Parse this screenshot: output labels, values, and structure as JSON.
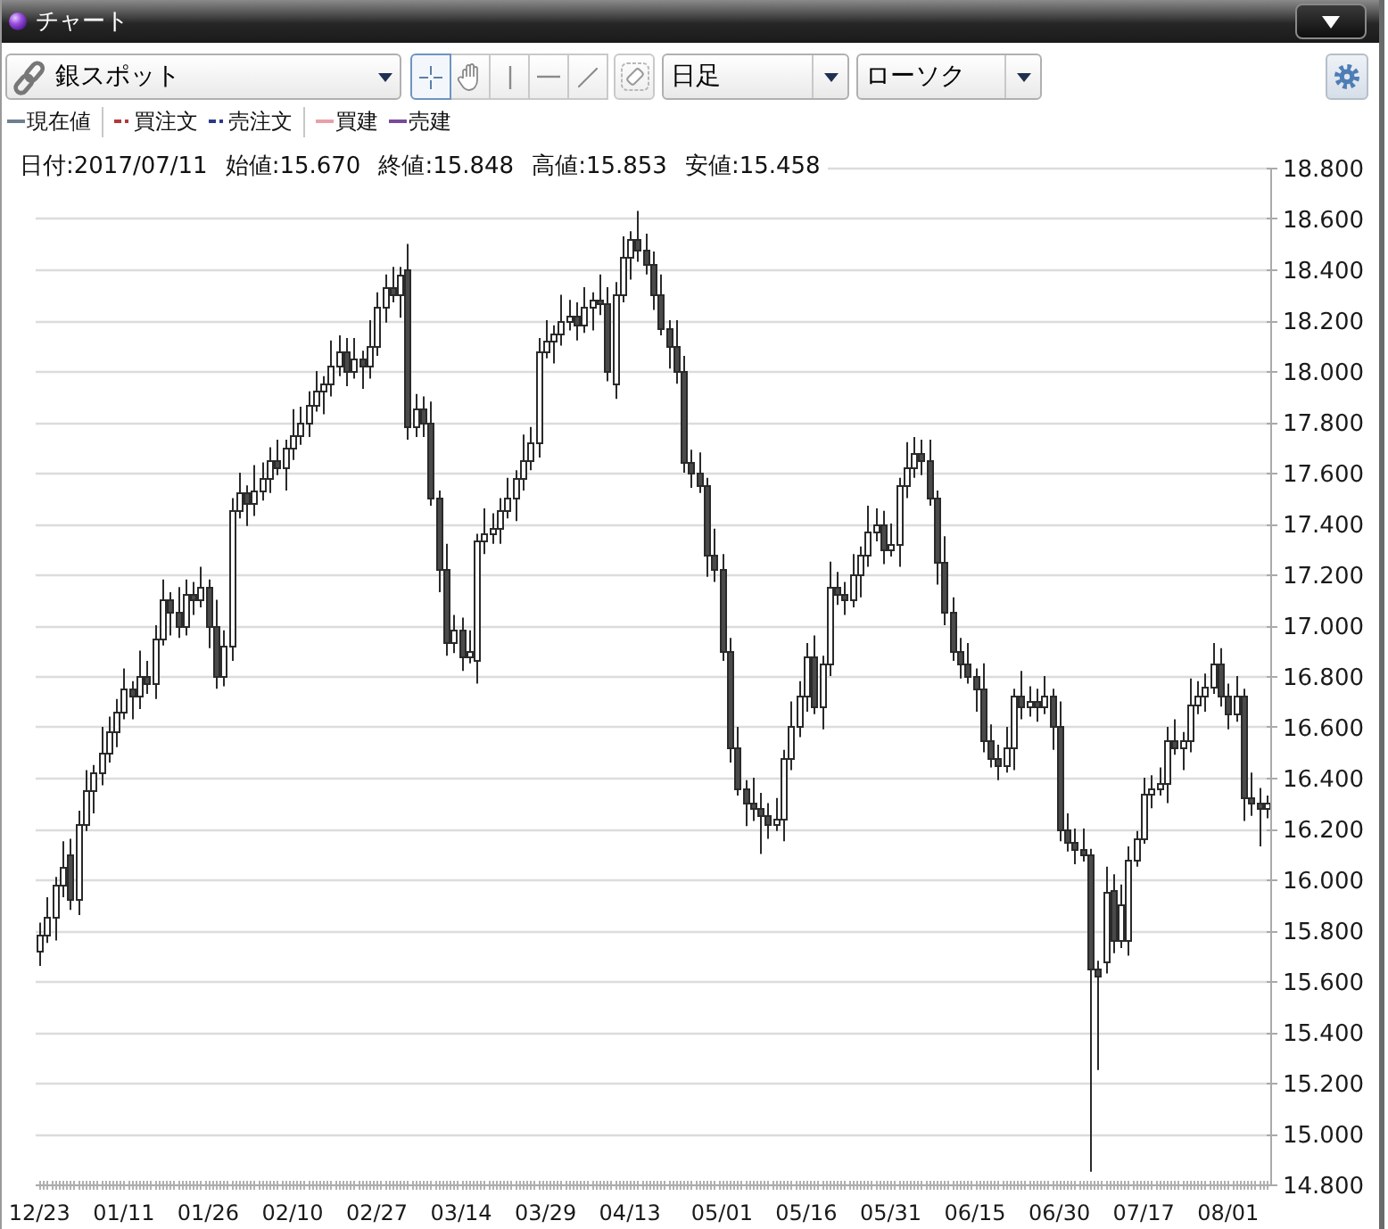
{
  "window": {
    "title": "チャート"
  },
  "toolbar": {
    "symbol": "銀スポット",
    "tools": [
      {
        "kind": "crosshair",
        "selected": true
      },
      {
        "kind": "hand",
        "selected": false
      },
      {
        "kind": "vertical-line",
        "selected": false
      },
      {
        "kind": "horizontal-line",
        "selected": false
      },
      {
        "kind": "trend-line",
        "selected": false
      },
      {
        "kind": "eraser",
        "selected": false
      }
    ],
    "period": "日足",
    "chart_type": "ローソク"
  },
  "legend": {
    "groups": [
      {
        "items": [
          {
            "label": "現在値",
            "color": "#6f7f8f",
            "kind": "solid"
          }
        ]
      },
      {
        "items": [
          {
            "label": "買注文",
            "color": "#b03a3a",
            "kind": "dashed"
          },
          {
            "label": "売注文",
            "color": "#2a3a8a",
            "kind": "dashed"
          }
        ]
      },
      {
        "items": [
          {
            "label": "買建",
            "color": "#e8a0a8",
            "kind": "solid"
          },
          {
            "label": "売建",
            "color": "#7a4a9a",
            "kind": "solid"
          }
        ]
      }
    ]
  },
  "ohlc_info": [
    "日付:2017/07/11",
    "始値:15.670",
    "終値:15.848",
    "高値:15.853",
    "安値:15.458"
  ],
  "chart": {
    "chart_data": {
      "type": "candlestick",
      "grid": true,
      "categories": [
        "12/23",
        null,
        null,
        null,
        null,
        null,
        null,
        null,
        null,
        null,
        null,
        "01/11",
        null,
        null,
        null,
        null,
        null,
        null,
        null,
        null,
        null,
        null,
        "01/26",
        null,
        null,
        null,
        null,
        null,
        null,
        null,
        null,
        null,
        null,
        "02/10",
        null,
        null,
        null,
        null,
        null,
        null,
        null,
        null,
        null,
        null,
        "02/27",
        null,
        null,
        null,
        null,
        null,
        null,
        null,
        null,
        null,
        null,
        "03/14",
        null,
        null,
        null,
        null,
        null,
        null,
        null,
        null,
        null,
        null,
        "03/29",
        null,
        null,
        null,
        null,
        null,
        null,
        null,
        null,
        null,
        null,
        "04/13",
        null,
        null,
        null,
        null,
        null,
        null,
        null,
        null,
        null,
        null,
        null,
        "05/01",
        null,
        null,
        null,
        null,
        null,
        null,
        null,
        null,
        null,
        null,
        "05/16",
        null,
        null,
        null,
        null,
        null,
        null,
        null,
        null,
        null,
        null,
        "05/31",
        null,
        null,
        null,
        null,
        null,
        null,
        null,
        null,
        null,
        null,
        "06/15",
        null,
        null,
        null,
        null,
        null,
        null,
        null,
        null,
        null,
        null,
        "06/30",
        null,
        null,
        null,
        null,
        null,
        null,
        null,
        null,
        null,
        null,
        "07/17",
        null,
        null,
        null,
        null,
        null,
        null,
        null,
        null,
        null,
        null,
        "08/01",
        null,
        null,
        null,
        null,
        null
      ],
      "ohlc": [
        [
          15.72,
          15.83,
          15.66,
          15.78
        ],
        [
          15.78,
          15.93,
          15.75,
          15.85
        ],
        [
          15.85,
          16.01,
          15.76,
          15.98
        ],
        [
          15.98,
          16.15,
          15.93,
          16.05
        ],
        [
          16.1,
          16.16,
          15.88,
          15.92
        ],
        [
          15.92,
          16.27,
          15.86,
          16.22
        ],
        [
          16.22,
          16.43,
          16.19,
          16.35
        ],
        [
          16.35,
          16.45,
          16.26,
          16.42
        ],
        [
          16.42,
          16.6,
          16.37,
          16.5
        ],
        [
          16.5,
          16.64,
          16.46,
          16.58
        ],
        [
          16.58,
          16.71,
          16.52,
          16.66
        ],
        [
          16.66,
          16.83,
          16.63,
          16.75
        ],
        [
          16.75,
          16.78,
          16.63,
          16.72
        ],
        [
          16.72,
          16.9,
          16.67,
          16.8
        ],
        [
          16.8,
          16.86,
          16.73,
          16.77
        ],
        [
          16.77,
          17.0,
          16.71,
          16.95
        ],
        [
          16.95,
          17.18,
          16.92,
          17.1
        ],
        [
          17.1,
          17.13,
          16.96,
          17.05
        ],
        [
          17.05,
          17.15,
          16.95,
          17.0
        ],
        [
          17.0,
          17.18,
          16.96,
          17.12
        ],
        [
          17.12,
          17.17,
          17.04,
          17.1
        ],
        [
          17.1,
          17.23,
          17.07,
          17.15
        ],
        [
          17.15,
          17.18,
          16.91,
          17.0
        ],
        [
          17.0,
          17.1,
          16.75,
          16.8
        ],
        [
          16.8,
          16.98,
          16.76,
          16.92
        ],
        [
          16.92,
          17.5,
          16.86,
          17.45
        ],
        [
          17.45,
          17.6,
          17.42,
          17.52
        ],
        [
          17.52,
          17.55,
          17.39,
          17.48
        ],
        [
          17.48,
          17.63,
          17.43,
          17.53
        ],
        [
          17.53,
          17.64,
          17.49,
          17.58
        ],
        [
          17.58,
          17.7,
          17.52,
          17.65
        ],
        [
          17.65,
          17.73,
          17.59,
          17.62
        ],
        [
          17.62,
          17.73,
          17.53,
          17.7
        ],
        [
          17.7,
          17.85,
          17.65,
          17.75
        ],
        [
          17.75,
          17.86,
          17.71,
          17.8
        ],
        [
          17.8,
          17.92,
          17.74,
          17.87
        ],
        [
          17.87,
          18.0,
          17.84,
          17.92
        ],
        [
          17.92,
          17.98,
          17.83,
          17.95
        ],
        [
          17.95,
          18.12,
          17.9,
          18.02
        ],
        [
          18.02,
          18.14,
          17.98,
          18.08
        ],
        [
          18.08,
          18.13,
          17.94,
          18.0
        ],
        [
          18.0,
          18.13,
          17.97,
          18.05
        ],
        [
          18.05,
          18.08,
          17.93,
          18.02
        ],
        [
          18.02,
          18.2,
          17.97,
          18.1
        ],
        [
          18.1,
          18.31,
          18.06,
          18.25
        ],
        [
          18.25,
          18.38,
          18.19,
          18.33
        ],
        [
          18.33,
          18.41,
          18.27,
          18.3
        ],
        [
          18.3,
          18.41,
          18.21,
          18.38
        ],
        [
          18.4,
          18.5,
          17.73,
          17.78
        ],
        [
          17.78,
          17.91,
          17.74,
          17.85
        ],
        [
          17.85,
          17.9,
          17.74,
          17.8
        ],
        [
          17.8,
          17.88,
          17.47,
          17.5
        ],
        [
          17.5,
          17.53,
          17.13,
          17.22
        ],
        [
          17.22,
          17.32,
          16.88,
          16.93
        ],
        [
          16.93,
          17.04,
          16.89,
          16.98
        ],
        [
          16.98,
          17.03,
          16.82,
          16.88
        ],
        [
          16.88,
          16.98,
          16.85,
          16.9
        ],
        [
          16.86,
          17.36,
          16.77,
          17.33
        ],
        [
          17.33,
          17.46,
          17.28,
          17.36
        ],
        [
          17.36,
          17.44,
          17.32,
          17.38
        ],
        [
          17.38,
          17.5,
          17.32,
          17.45
        ],
        [
          17.45,
          17.58,
          17.42,
          17.5
        ],
        [
          17.5,
          17.61,
          17.41,
          17.58
        ],
        [
          17.58,
          17.75,
          17.53,
          17.65
        ],
        [
          17.65,
          17.78,
          17.61,
          17.72
        ],
        [
          17.72,
          18.13,
          17.66,
          18.08
        ],
        [
          18.08,
          18.2,
          18.05,
          18.12
        ],
        [
          18.12,
          18.18,
          18.03,
          18.15
        ],
        [
          18.15,
          18.3,
          18.1,
          18.2
        ],
        [
          18.2,
          18.28,
          18.16,
          18.22
        ],
        [
          18.22,
          18.27,
          18.12,
          18.18
        ],
        [
          18.18,
          18.33,
          18.15,
          18.25
        ],
        [
          18.25,
          18.31,
          18.16,
          18.28
        ],
        [
          18.28,
          18.38,
          18.22,
          18.27
        ],
        [
          18.27,
          18.33,
          17.96,
          18.0
        ],
        [
          17.95,
          18.35,
          17.89,
          18.3
        ],
        [
          18.3,
          18.53,
          18.27,
          18.45
        ],
        [
          18.45,
          18.55,
          18.36,
          18.52
        ],
        [
          18.52,
          18.63,
          18.43,
          18.48
        ],
        [
          18.48,
          18.54,
          18.38,
          18.42
        ],
        [
          18.42,
          18.47,
          18.24,
          18.3
        ],
        [
          18.3,
          18.38,
          18.14,
          18.17
        ],
        [
          18.17,
          18.2,
          18.01,
          18.1
        ],
        [
          18.1,
          18.2,
          17.95,
          18.0
        ],
        [
          18.0,
          18.06,
          17.6,
          17.64
        ],
        [
          17.64,
          17.69,
          17.54,
          17.6
        ],
        [
          17.6,
          17.68,
          17.52,
          17.55
        ],
        [
          17.55,
          17.58,
          17.19,
          17.28
        ],
        [
          17.28,
          17.38,
          17.17,
          17.22
        ],
        [
          17.22,
          17.28,
          16.86,
          16.9
        ],
        [
          16.9,
          16.95,
          16.46,
          16.52
        ],
        [
          16.52,
          16.6,
          16.33,
          16.36
        ],
        [
          16.36,
          16.39,
          16.21,
          16.3
        ],
        [
          16.3,
          16.4,
          16.23,
          16.28
        ],
        [
          16.28,
          16.34,
          16.1,
          16.25
        ],
        [
          16.25,
          16.3,
          16.16,
          16.22
        ],
        [
          16.22,
          16.32,
          16.19,
          16.24
        ],
        [
          16.24,
          16.51,
          16.15,
          16.48
        ],
        [
          16.48,
          16.7,
          16.43,
          16.6
        ],
        [
          16.6,
          16.78,
          16.56,
          16.72
        ],
        [
          16.72,
          16.93,
          16.66,
          16.88
        ],
        [
          16.88,
          16.96,
          16.65,
          16.68
        ],
        [
          16.68,
          16.88,
          16.59,
          16.85
        ],
        [
          16.85,
          17.25,
          16.8,
          17.15
        ],
        [
          17.15,
          17.21,
          17.08,
          17.12
        ],
        [
          17.12,
          17.17,
          17.04,
          17.1
        ],
        [
          17.1,
          17.28,
          17.07,
          17.2
        ],
        [
          17.2,
          17.31,
          17.11,
          17.28
        ],
        [
          17.28,
          17.47,
          17.23,
          17.37
        ],
        [
          17.37,
          17.46,
          17.33,
          17.4
        ],
        [
          17.4,
          17.45,
          17.24,
          17.3
        ],
        [
          17.3,
          17.4,
          17.27,
          17.32
        ],
        [
          17.32,
          17.58,
          17.23,
          17.55
        ],
        [
          17.55,
          17.72,
          17.5,
          17.62
        ],
        [
          17.62,
          17.74,
          17.58,
          17.68
        ],
        [
          17.68,
          17.73,
          17.59,
          17.65
        ],
        [
          17.65,
          17.73,
          17.47,
          17.5
        ],
        [
          17.5,
          17.53,
          17.16,
          17.25
        ],
        [
          17.25,
          17.35,
          17.0,
          17.05
        ],
        [
          17.05,
          17.11,
          16.86,
          16.9
        ],
        [
          16.9,
          16.95,
          16.79,
          16.85
        ],
        [
          16.85,
          16.93,
          16.77,
          16.8
        ],
        [
          16.8,
          16.83,
          16.66,
          16.75
        ],
        [
          16.75,
          16.85,
          16.5,
          16.55
        ],
        [
          16.55,
          16.61,
          16.44,
          16.48
        ],
        [
          16.48,
          16.53,
          16.39,
          16.45
        ],
        [
          16.45,
          16.6,
          16.42,
          16.52
        ],
        [
          16.52,
          16.75,
          16.43,
          16.72
        ],
        [
          16.72,
          16.82,
          16.63,
          16.68
        ],
        [
          16.68,
          16.76,
          16.64,
          16.7
        ],
        [
          16.7,
          16.75,
          16.62,
          16.68
        ],
        [
          16.68,
          16.8,
          16.65,
          16.72
        ],
        [
          16.72,
          16.75,
          16.51,
          16.6
        ],
        [
          16.6,
          16.7,
          16.15,
          16.2
        ],
        [
          16.2,
          16.26,
          16.11,
          16.15
        ],
        [
          16.15,
          16.2,
          16.06,
          16.12
        ],
        [
          16.12,
          16.2,
          16.07,
          16.1
        ],
        [
          16.1,
          16.12,
          14.85,
          15.65
        ],
        [
          15.65,
          15.68,
          15.25,
          15.62
        ],
        [
          15.68,
          16.05,
          15.63,
          15.95
        ],
        [
          15.96,
          16.02,
          15.71,
          15.76
        ],
        [
          15.76,
          15.98,
          15.73,
          15.9
        ],
        [
          15.76,
          16.13,
          15.7,
          16.08
        ],
        [
          16.08,
          16.19,
          16.05,
          16.16
        ],
        [
          16.16,
          16.4,
          16.14,
          16.34
        ],
        [
          16.34,
          16.41,
          16.28,
          16.36
        ],
        [
          16.36,
          16.44,
          16.33,
          16.38
        ],
        [
          16.38,
          16.6,
          16.3,
          16.55
        ],
        [
          16.55,
          16.63,
          16.49,
          16.52
        ],
        [
          16.52,
          16.58,
          16.43,
          16.55
        ],
        [
          16.55,
          16.79,
          16.5,
          16.69
        ],
        [
          16.69,
          16.78,
          16.65,
          16.72
        ],
        [
          16.72,
          16.81,
          16.66,
          16.76
        ],
        [
          16.76,
          16.93,
          16.73,
          16.85
        ],
        [
          16.85,
          16.91,
          16.68,
          16.72
        ],
        [
          16.72,
          16.77,
          16.59,
          16.65
        ],
        [
          16.65,
          16.8,
          16.62,
          16.72
        ],
        [
          16.72,
          16.75,
          16.23,
          16.32
        ],
        [
          16.32,
          16.42,
          16.25,
          16.3
        ],
        [
          16.3,
          16.36,
          16.13,
          16.28
        ],
        [
          16.28,
          16.33,
          16.24,
          16.3
        ]
      ],
      "ylim": [
        14.8,
        18.8
      ],
      "yticks": [
        {
          "value": 18.8,
          "label": "18.800"
        },
        {
          "value": 18.6,
          "label": "18.600"
        },
        {
          "value": 18.4,
          "label": "18.400"
        },
        {
          "value": 18.2,
          "label": "18.200"
        },
        {
          "value": 18.0,
          "label": "18.000"
        },
        {
          "value": 17.8,
          "label": "17.800"
        },
        {
          "value": 17.6,
          "label": "17.600"
        },
        {
          "value": 17.4,
          "label": "17.400"
        },
        {
          "value": 17.2,
          "label": "17.200"
        },
        {
          "value": 17.0,
          "label": "17.000"
        },
        {
          "value": 16.8,
          "label": "16.800"
        },
        {
          "value": 16.6,
          "label": "16.600"
        },
        {
          "value": 16.4,
          "label": "16.400"
        },
        {
          "value": 16.2,
          "label": "16.200"
        },
        {
          "value": 16.0,
          "label": "16.000"
        },
        {
          "value": 15.8,
          "label": "15.800"
        },
        {
          "value": 15.6,
          "label": "15.600"
        },
        {
          "value": 15.4,
          "label": "15.400"
        },
        {
          "value": 15.2,
          "label": "15.200"
        },
        {
          "value": 15.0,
          "label": "15.000"
        },
        {
          "value": 14.8,
          "label": "14.800"
        }
      ]
    }
  }
}
